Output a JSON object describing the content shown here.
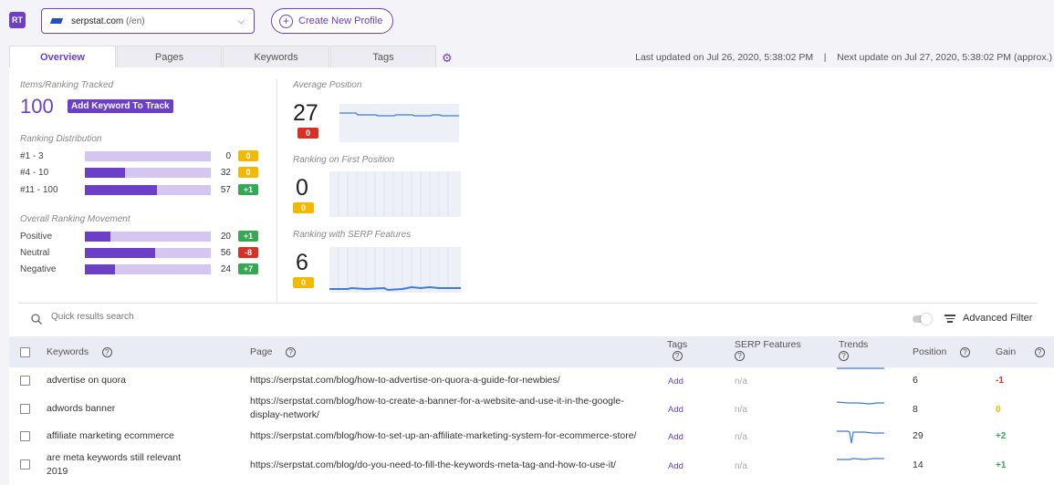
{
  "header": {
    "logo": "RT",
    "profile": {
      "domain": "serpstat.com",
      "locale": "(/en)"
    },
    "create_label": "Create New Profile"
  },
  "tabs": [
    {
      "label": "Overview",
      "active": true
    },
    {
      "label": "Pages",
      "active": false
    },
    {
      "label": "Keywords",
      "active": false
    },
    {
      "label": "Tags",
      "active": false
    }
  ],
  "status": {
    "last_updated": "Last updated on Jul 26, 2020, 5:38:02 PM",
    "separator": "|",
    "next_update": "Next update on Jul 27, 2020, 5:38:02 PM (approx.)"
  },
  "overview": {
    "items_label": "Items/Ranking Tracked",
    "items_count": "100",
    "add_keyword_label": "Add Keyword To Track",
    "distribution_label": "Ranking Distribution",
    "distribution": [
      {
        "name": "#1 - 3",
        "count": "0",
        "fill": 0.0,
        "badge": "0",
        "badge_color": "yellow"
      },
      {
        "name": "#4 - 10",
        "count": "32",
        "fill": 0.32,
        "badge": "0",
        "badge_color": "yellow"
      },
      {
        "name": "#11 - 100",
        "count": "57",
        "fill": 0.57,
        "badge": "+1",
        "badge_color": "green"
      }
    ],
    "movement_label": "Overall Ranking Movement",
    "movement": [
      {
        "name": "Positive",
        "count": "20",
        "fill": 0.2,
        "badge": "+1",
        "badge_color": "green"
      },
      {
        "name": "Neutral",
        "count": "56",
        "fill": 0.56,
        "badge": "-8",
        "badge_color": "red"
      },
      {
        "name": "Negative",
        "count": "24",
        "fill": 0.24,
        "badge": "+7",
        "badge_color": "green"
      }
    ],
    "stats": [
      {
        "label": "Average Position",
        "value": "27",
        "badge": "0",
        "badge_color": "red"
      },
      {
        "label": "Ranking on First Position",
        "value": "0",
        "badge": "0",
        "badge_color": "yellow"
      },
      {
        "label": "Ranking with SERP Features",
        "value": "6",
        "badge": "0",
        "badge_color": "yellow"
      }
    ]
  },
  "search": {
    "placeholder": "Quick results search"
  },
  "advanced_filter_label": "Advanced Filter",
  "table": {
    "headers": {
      "keywords": "Keywords",
      "page": "Page",
      "tags": "Tags",
      "serp": "SERP Features",
      "trends": "Trends",
      "position": "Position",
      "gain": "Gain"
    },
    "rows": [
      {
        "keyword": "advertise on quora",
        "page": "https://serpstat.com/blog/how-to-advertise-on-quora-a-guide-for-newbies/",
        "tags": "Add",
        "serp": "n/a",
        "position": "6",
        "gain": "-1",
        "gain_type": "neg"
      },
      {
        "keyword": "adwords banner",
        "page": "https://serpstat.com/blog/how-to-create-a-banner-for-a-website-and-use-it-in-the-google-display-network/",
        "tags": "Add",
        "serp": "n/a",
        "position": "8",
        "gain": "0",
        "gain_type": "zero"
      },
      {
        "keyword": "affiliate marketing ecommerce",
        "page": "https://serpstat.com/blog/how-to-set-up-an-affiliate-marketing-system-for-ecommerce-store/",
        "tags": "Add",
        "serp": "n/a",
        "position": "29",
        "gain": "+2",
        "gain_type": "pos"
      },
      {
        "keyword": "are meta keywords still relevant 2019",
        "page": "https://serpstat.com/blog/do-you-need-to-fill-the-keywords-meta-tag-and-how-to-use-it/",
        "tags": "Add",
        "serp": "n/a",
        "position": "14",
        "gain": "+1",
        "gain_type": "pos"
      }
    ]
  },
  "colors": {
    "accent": "#6b3fc7",
    "green": "#34a853",
    "red": "#d93025",
    "yellow": "#f5b800"
  }
}
